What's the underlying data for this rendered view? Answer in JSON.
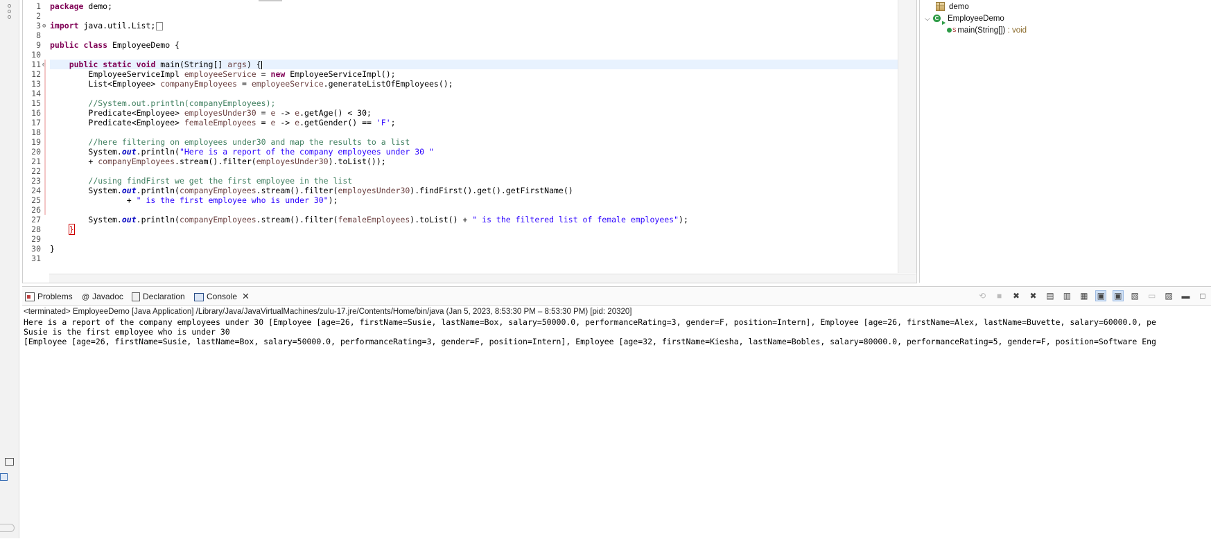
{
  "editor": {
    "line_numbers": [
      "1",
      "2",
      "3",
      "8",
      "9",
      "10",
      "11",
      "12",
      "13",
      "14",
      "15",
      "16",
      "17",
      "18",
      "19",
      "20",
      "21",
      "22",
      "23",
      "24",
      "25",
      "26",
      "27",
      "28",
      "29",
      "30",
      "31"
    ],
    "lines": {
      "l1_kw": "package",
      "l1_rest": " demo;",
      "l3_kw": "import",
      "l3_rest": " java.util.List;",
      "l9_kw1": "public",
      "l9_kw2": "class",
      "l9_rest": " EmployeeDemo {",
      "l11_kw1": "public",
      "l11_kw2": "static",
      "l11_kw3": "void",
      "l11_a": " main(String[] ",
      "l11_var": "args",
      "l11_b": ") {",
      "l12_a": "EmployeeServiceImpl ",
      "l12_var": "employeeService",
      "l12_b": " = ",
      "l12_kw": "new",
      "l12_c": " EmployeeServiceImpl();",
      "l13_a": "List<Employee> ",
      "l13_var1": "companyEmployees",
      "l13_b": " = ",
      "l13_var2": "employeeService",
      "l13_c": ".generateListOfEmployees();",
      "l15_cm": "//System.out.println(companyEmployees);",
      "l16_a": "Predicate<Employee> ",
      "l16_var1": "employesUnder30",
      "l16_b": " = ",
      "l16_var2": "e",
      "l16_c": " -> ",
      "l16_var3": "e",
      "l16_d": ".getAge() < 30;",
      "l17_a": "Predicate<Employee> ",
      "l17_var1": "femaleEmployees",
      "l17_b": " = ",
      "l17_var2": "e",
      "l17_c": " -> ",
      "l17_var3": "e",
      "l17_d": ".getGender() == ",
      "l17_str": "'F'",
      "l17_e": ";",
      "l19_cm": "//here filtering on employees under30 and map the results to a list",
      "l20_a": "System.",
      "l20_fld": "out",
      "l20_b": ".println(",
      "l20_str": "\"Here is a report of the company employees under 30 \"",
      "l21_a": "+ ",
      "l21_var1": "companyEmployees",
      "l21_b": ".stream().filter(",
      "l21_var2": "employesUnder30",
      "l21_c": ").toList());",
      "l23_cm": "//using findFirst we get the first employee in the list",
      "l24_a": "System.",
      "l24_fld": "out",
      "l24_b": ".println(",
      "l24_var1": "companyEmployees",
      "l24_c": ".stream().filter(",
      "l24_var2": "employesUnder30",
      "l24_d": ").findFirst().get().getFirstName()",
      "l25_a": "+ ",
      "l25_str": "\" is the first employee who is under 30\"",
      "l25_b": ");",
      "l27_a": "System.",
      "l27_fld": "out",
      "l27_b": ".println(",
      "l27_var1": "companyEmployees",
      "l27_c": ".stream().filter(",
      "l27_var2": "femaleEmployees",
      "l27_d": ").toList() + ",
      "l27_str": "\" is the filtered list of female employees\"",
      "l27_e": ");",
      "l28_br": "}",
      "l30_br": "}"
    }
  },
  "outline": {
    "package": "demo",
    "class": "EmployeeDemo",
    "method": "main(String[])",
    "method_type": " : void",
    "static_marker": "S"
  },
  "bottom_panel": {
    "tabs": [
      {
        "label": "Problems"
      },
      {
        "label": "Javadoc",
        "prefix": "@"
      },
      {
        "label": "Declaration"
      },
      {
        "label": "Console",
        "close": "✕"
      }
    ],
    "console_header": "<terminated> EmployeeDemo [Java Application] /Library/Java/JavaVirtualMachines/zulu-17.jre/Contents/Home/bin/java  (Jan 5, 2023, 8:53:30 PM – 8:53:30 PM) [pid: 20320]",
    "output": [
      "Here is a report of the company employees under 30 [Employee [age=26, firstName=Susie, lastName=Box, salary=50000.0, performanceRating=3, gender=F, position=Intern], Employee [age=26, firstName=Alex, lastName=Buvette, salary=60000.0, pe",
      "Susie is the first employee who is under 30",
      "[Employee [age=26, firstName=Susie, lastName=Box, salary=50000.0, performanceRating=3, gender=F, position=Intern], Employee [age=32, firstName=Kiesha, lastName=Bobles, salary=80000.0, performanceRating=5, gender=F, position=Software Eng"
    ]
  }
}
